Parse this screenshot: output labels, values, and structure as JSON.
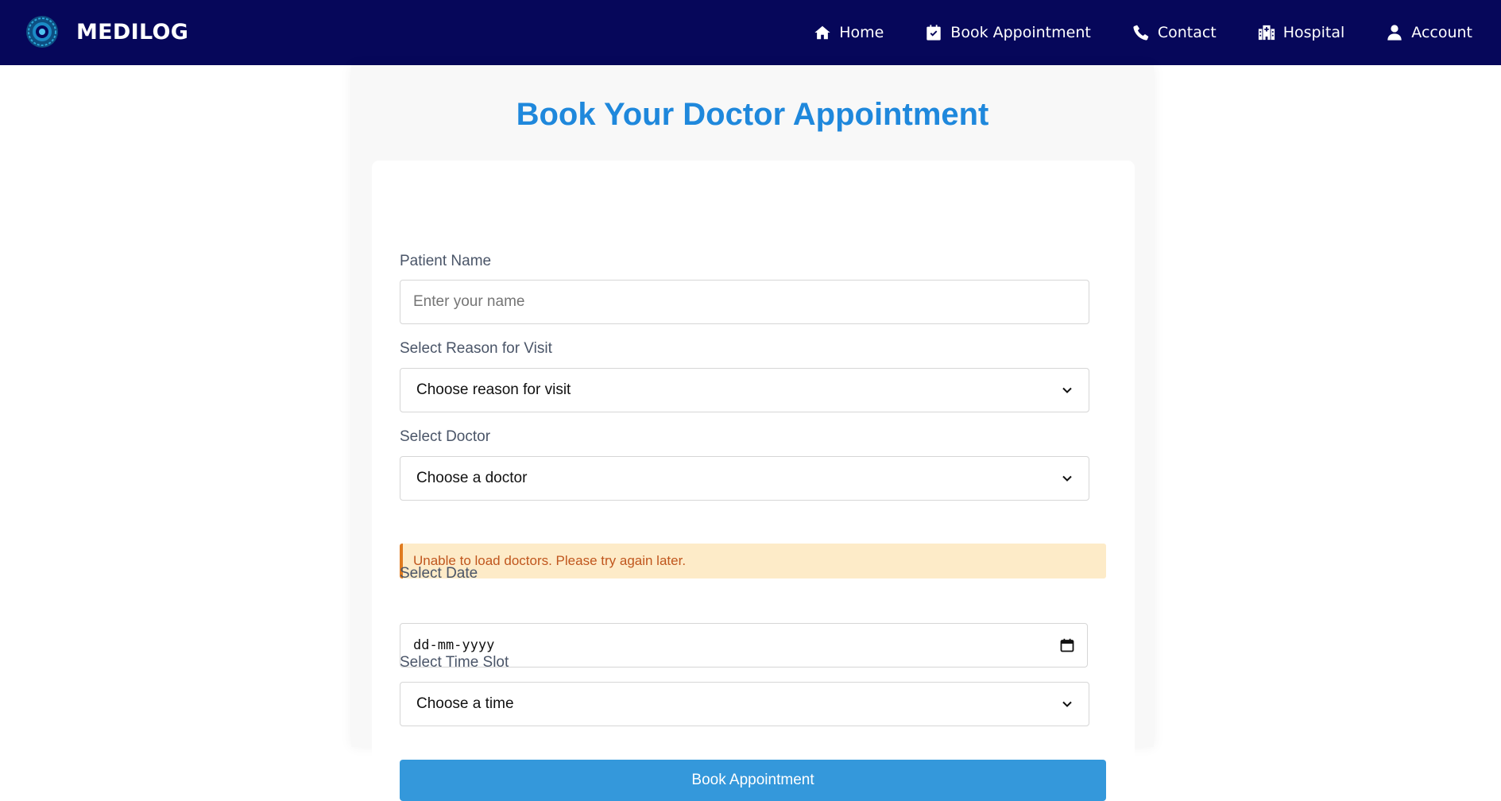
{
  "brand": {
    "name": "MEDILOG",
    "logo_icon": "medical-target-logo"
  },
  "nav": {
    "items": [
      {
        "label": "Home",
        "icon": "home-icon"
      },
      {
        "label": "Book Appointment",
        "icon": "calendar-check-icon"
      },
      {
        "label": "Contact",
        "icon": "phone-icon"
      },
      {
        "label": "Hospital",
        "icon": "hospital-icon"
      },
      {
        "label": "Account",
        "icon": "user-icon"
      }
    ]
  },
  "page": {
    "title": "Book Your Doctor Appointment"
  },
  "form": {
    "patient_name": {
      "label": "Patient Name",
      "placeholder": "Enter your name",
      "value": ""
    },
    "reason": {
      "label": "Select Reason for Visit",
      "selected": "Choose reason for visit"
    },
    "doctor": {
      "label": "Select Doctor",
      "selected": "Choose a doctor"
    },
    "error_message": "Unable to load doctors. Please try again later.",
    "date": {
      "label": "Select Date",
      "placeholder": "dd-mm-yyyy"
    },
    "time_slot": {
      "label": "Select Time Slot",
      "selected": "Choose a time"
    },
    "submit_label": "Book Appointment"
  },
  "colors": {
    "navbar_bg": "#06075a",
    "title": "#1f88dc",
    "button_bg": "#3498db",
    "alert_bg": "#fdebc8",
    "alert_border": "#e07b1f",
    "alert_text": "#c0561d"
  }
}
